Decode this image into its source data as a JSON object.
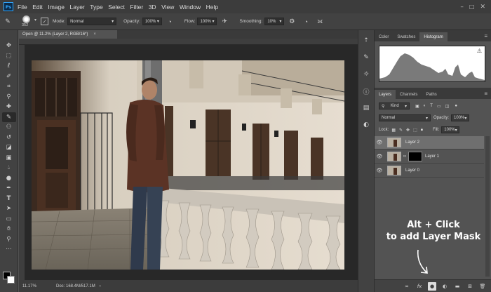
{
  "app": {
    "logo": "Ps"
  },
  "menu": [
    "File",
    "Edit",
    "Image",
    "Layer",
    "Type",
    "Select",
    "Filter",
    "3D",
    "View",
    "Window",
    "Help"
  ],
  "options_bar": {
    "brush_size": "352",
    "mode_label": "Mode:",
    "mode_value": "Normal",
    "opacity_label": "Opacity:",
    "opacity_value": "100%",
    "flow_label": "Flow:",
    "flow_value": "100%",
    "smoothing_label": "Smoothing:",
    "smoothing_value": "10%"
  },
  "document": {
    "tab_title": "Open @ 11.2% (Layer 2, RGB/16*)",
    "tab_close": "×",
    "zoom": "11.17%",
    "doc_info": "Doc: 168.4M/517.1M"
  },
  "panels": {
    "top_tabs": [
      "Color",
      "Swatches",
      "Histogram"
    ],
    "active_top_tab": "Histogram",
    "layer_tabs": [
      "Layers",
      "Channels",
      "Paths"
    ],
    "filter_label": "Kind",
    "blend_mode": "Normal",
    "opacity_label": "Opacity:",
    "opacity_value": "100%",
    "lock_label": "Lock:",
    "fill_label": "Fill:",
    "fill_value": "100%",
    "layers": [
      {
        "name": "Layer 2",
        "selected": true,
        "has_mask": false
      },
      {
        "name": "Layer 1",
        "selected": false,
        "has_mask": true
      },
      {
        "name": "Layer 0",
        "selected": false,
        "has_mask": false
      }
    ]
  },
  "callout": {
    "line1": "Alt + Click",
    "line2": "to add Layer Mask"
  },
  "icons": {
    "tools": [
      "move-icon",
      "marquee-icon",
      "lasso-icon",
      "quick-select-icon",
      "crop-icon",
      "eyedropper-icon",
      "healing-icon",
      "brush-icon",
      "stamp-icon",
      "history-brush-icon",
      "eraser-icon",
      "gradient-icon",
      "blur-icon",
      "dodge-icon",
      "pen-icon",
      "type-icon",
      "path-select-icon",
      "rectangle-icon",
      "hand-icon",
      "zoom-icon"
    ]
  },
  "colors": {
    "accent": "#31a8ff",
    "panel_bg": "#535353",
    "bar_bg": "#424242"
  }
}
